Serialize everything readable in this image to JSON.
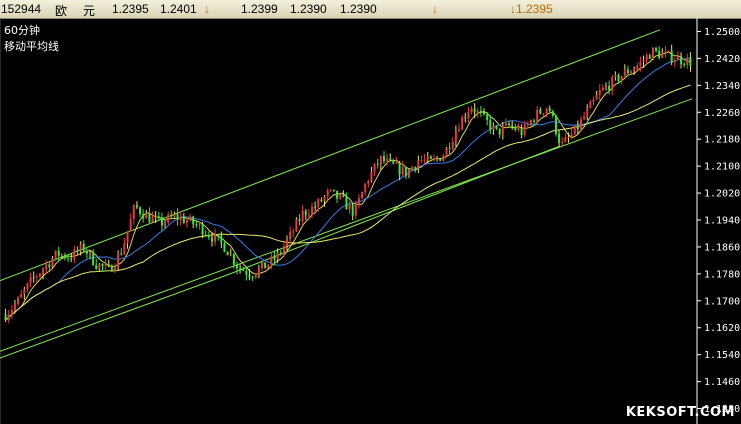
{
  "quote_bar": {
    "time": "152944",
    "symbol_a": "欧",
    "symbol_b": "元",
    "price_1": "1.2395",
    "price_2": "1.2401",
    "arrow_1": "↓",
    "price_3": "1.2399",
    "price_4": "1.2390",
    "price_5": "1.2390",
    "arrow_2": "↓",
    "last_price": "↓1.2395"
  },
  "chart_header": {
    "period": "60分钟",
    "indicator": "移动平均线"
  },
  "watermark": "KEKSOFT.COM",
  "colors": {
    "background": "#000000",
    "quote_bar": "#ece8cc",
    "axis": "#ffffff",
    "channel_line": "#7ee84a",
    "ma_fast": "#d8d84a",
    "ma_mid": "#3a7ae8",
    "ma_slow": "#e8e86a",
    "candle_up": "#e83a3a",
    "candle_down": "#3ae83a"
  },
  "chart_data": {
    "type": "candlestick",
    "title": "",
    "xlabel": "",
    "ylabel": "",
    "ylim": [
      1.134,
      1.254
    ],
    "y_ticks": [
      "1.2500",
      "1.2420",
      "1.2340",
      "1.2260",
      "1.2180",
      "1.2100",
      "1.2020",
      "1.1940",
      "1.1860",
      "1.1780",
      "1.1700",
      "1.1620",
      "1.1540",
      "1.1460",
      "1.1380"
    ],
    "close_series": [
      1.166,
      1.17,
      1.176,
      1.18,
      1.184,
      1.183,
      1.186,
      1.181,
      1.179,
      1.185,
      1.198,
      1.195,
      1.193,
      1.195,
      1.194,
      1.192,
      1.189,
      1.186,
      1.18,
      1.178,
      1.18,
      1.183,
      1.189,
      1.196,
      1.198,
      1.202,
      1.2,
      1.196,
      1.206,
      1.212,
      1.21,
      1.208,
      1.212,
      1.211,
      1.214,
      1.222,
      1.228,
      1.224,
      1.22,
      1.222,
      1.22,
      1.225,
      1.228,
      1.216,
      1.22,
      1.226,
      1.232,
      1.235,
      1.238,
      1.24,
      1.244,
      1.243,
      1.242,
      1.241
    ]
  }
}
